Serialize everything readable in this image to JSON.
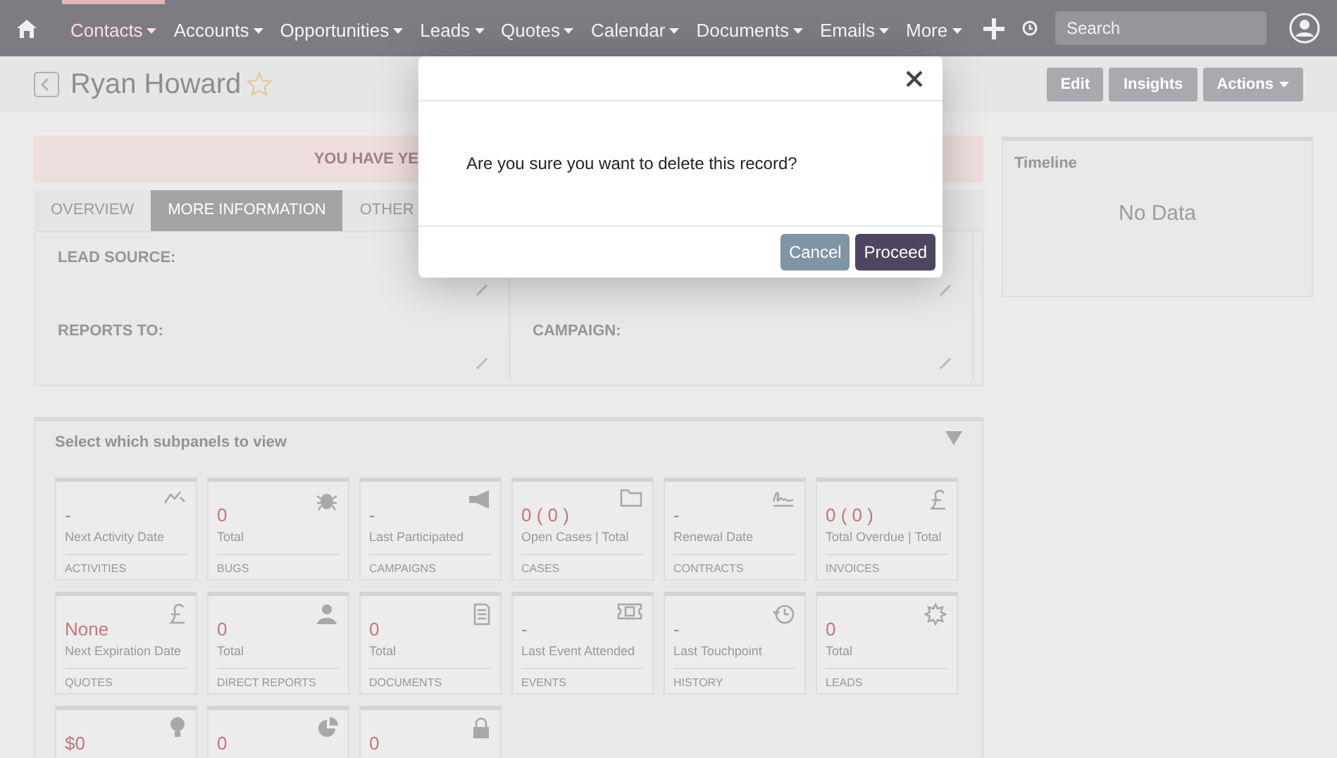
{
  "navbar": {
    "items": [
      {
        "label": "Contacts",
        "selected": true
      },
      {
        "label": "Accounts",
        "selected": false
      },
      {
        "label": "Opportunities",
        "selected": false
      },
      {
        "label": "Leads",
        "selected": false
      },
      {
        "label": "Quotes",
        "selected": false
      },
      {
        "label": "Calendar",
        "selected": false
      },
      {
        "label": "Documents",
        "selected": false
      },
      {
        "label": "Emails",
        "selected": false
      },
      {
        "label": "More",
        "selected": false
      }
    ],
    "search": {
      "placeholder": "Search"
    }
  },
  "record": {
    "title": "Ryan Howard",
    "starred": false
  },
  "actions": [
    {
      "label": "Edit",
      "kind": "button"
    },
    {
      "label": "Insights",
      "kind": "button"
    },
    {
      "label": "Actions",
      "kind": "dropdown"
    }
  ],
  "alert": {
    "text": "YOU HAVE YE"
  },
  "tabs": [
    {
      "label": "OVERVIEW",
      "selected": false
    },
    {
      "label": "MORE INFORMATION",
      "selected": true
    },
    {
      "label": "OTHER",
      "selected": false
    }
  ],
  "field_rows": [
    {
      "left": "LEAD SOURCE:"
    },
    {
      "left": "REPORTS TO:",
      "right": "CAMPAIGN:"
    }
  ],
  "timeline": {
    "title": "Timeline",
    "empty_text": "No Data"
  },
  "subpanels": {
    "title": "Select which subpanels to view",
    "cards": [
      {
        "kind": "trend",
        "value": "-",
        "caption": "Next Activity Date",
        "name": "ACTIVITIES"
      },
      {
        "kind": "bug",
        "value": "0",
        "caption": "Total",
        "name": "BUGS"
      },
      {
        "kind": "megaphone",
        "value": "-",
        "caption": "Last Participated",
        "name": "CAMPAIGNS"
      },
      {
        "kind": "folder",
        "value": "0 ( 0 )",
        "caption": "Open Cases | Total",
        "name": "CASES"
      },
      {
        "kind": "signature",
        "value": "-",
        "caption": "Renewal Date",
        "name": "CONTRACTS"
      },
      {
        "kind": "pound",
        "value": "0 ( 0 )",
        "caption": "Total Overdue | Total",
        "name": "INVOICES"
      },
      {
        "kind": "pound",
        "value": "None",
        "caption": "Next Expiration Date",
        "name": "QUOTES"
      },
      {
        "kind": "person",
        "value": "0",
        "caption": "Total",
        "name": "DIRECT REPORTS"
      },
      {
        "kind": "document",
        "value": "0",
        "caption": "Total",
        "name": "DOCUMENTS"
      },
      {
        "kind": "ticket",
        "value": "-",
        "caption": "Last Event Attended",
        "name": "EVENTS"
      },
      {
        "kind": "clock",
        "value": "-",
        "caption": "Last Touchpoint",
        "name": "HISTORY"
      },
      {
        "kind": "star",
        "value": "0",
        "caption": "Total",
        "name": "LEADS"
      },
      {
        "kind": "bulb",
        "value": "$0"
      },
      {
        "kind": "pie",
        "value": "0"
      },
      {
        "kind": "lock",
        "value": "0"
      }
    ]
  },
  "dialog": {
    "message": "Are you sure you want to delete this record?",
    "buttons": [
      {
        "label": "Cancel",
        "kind": "secondary"
      },
      {
        "label": "Proceed",
        "kind": "primary"
      }
    ]
  }
}
